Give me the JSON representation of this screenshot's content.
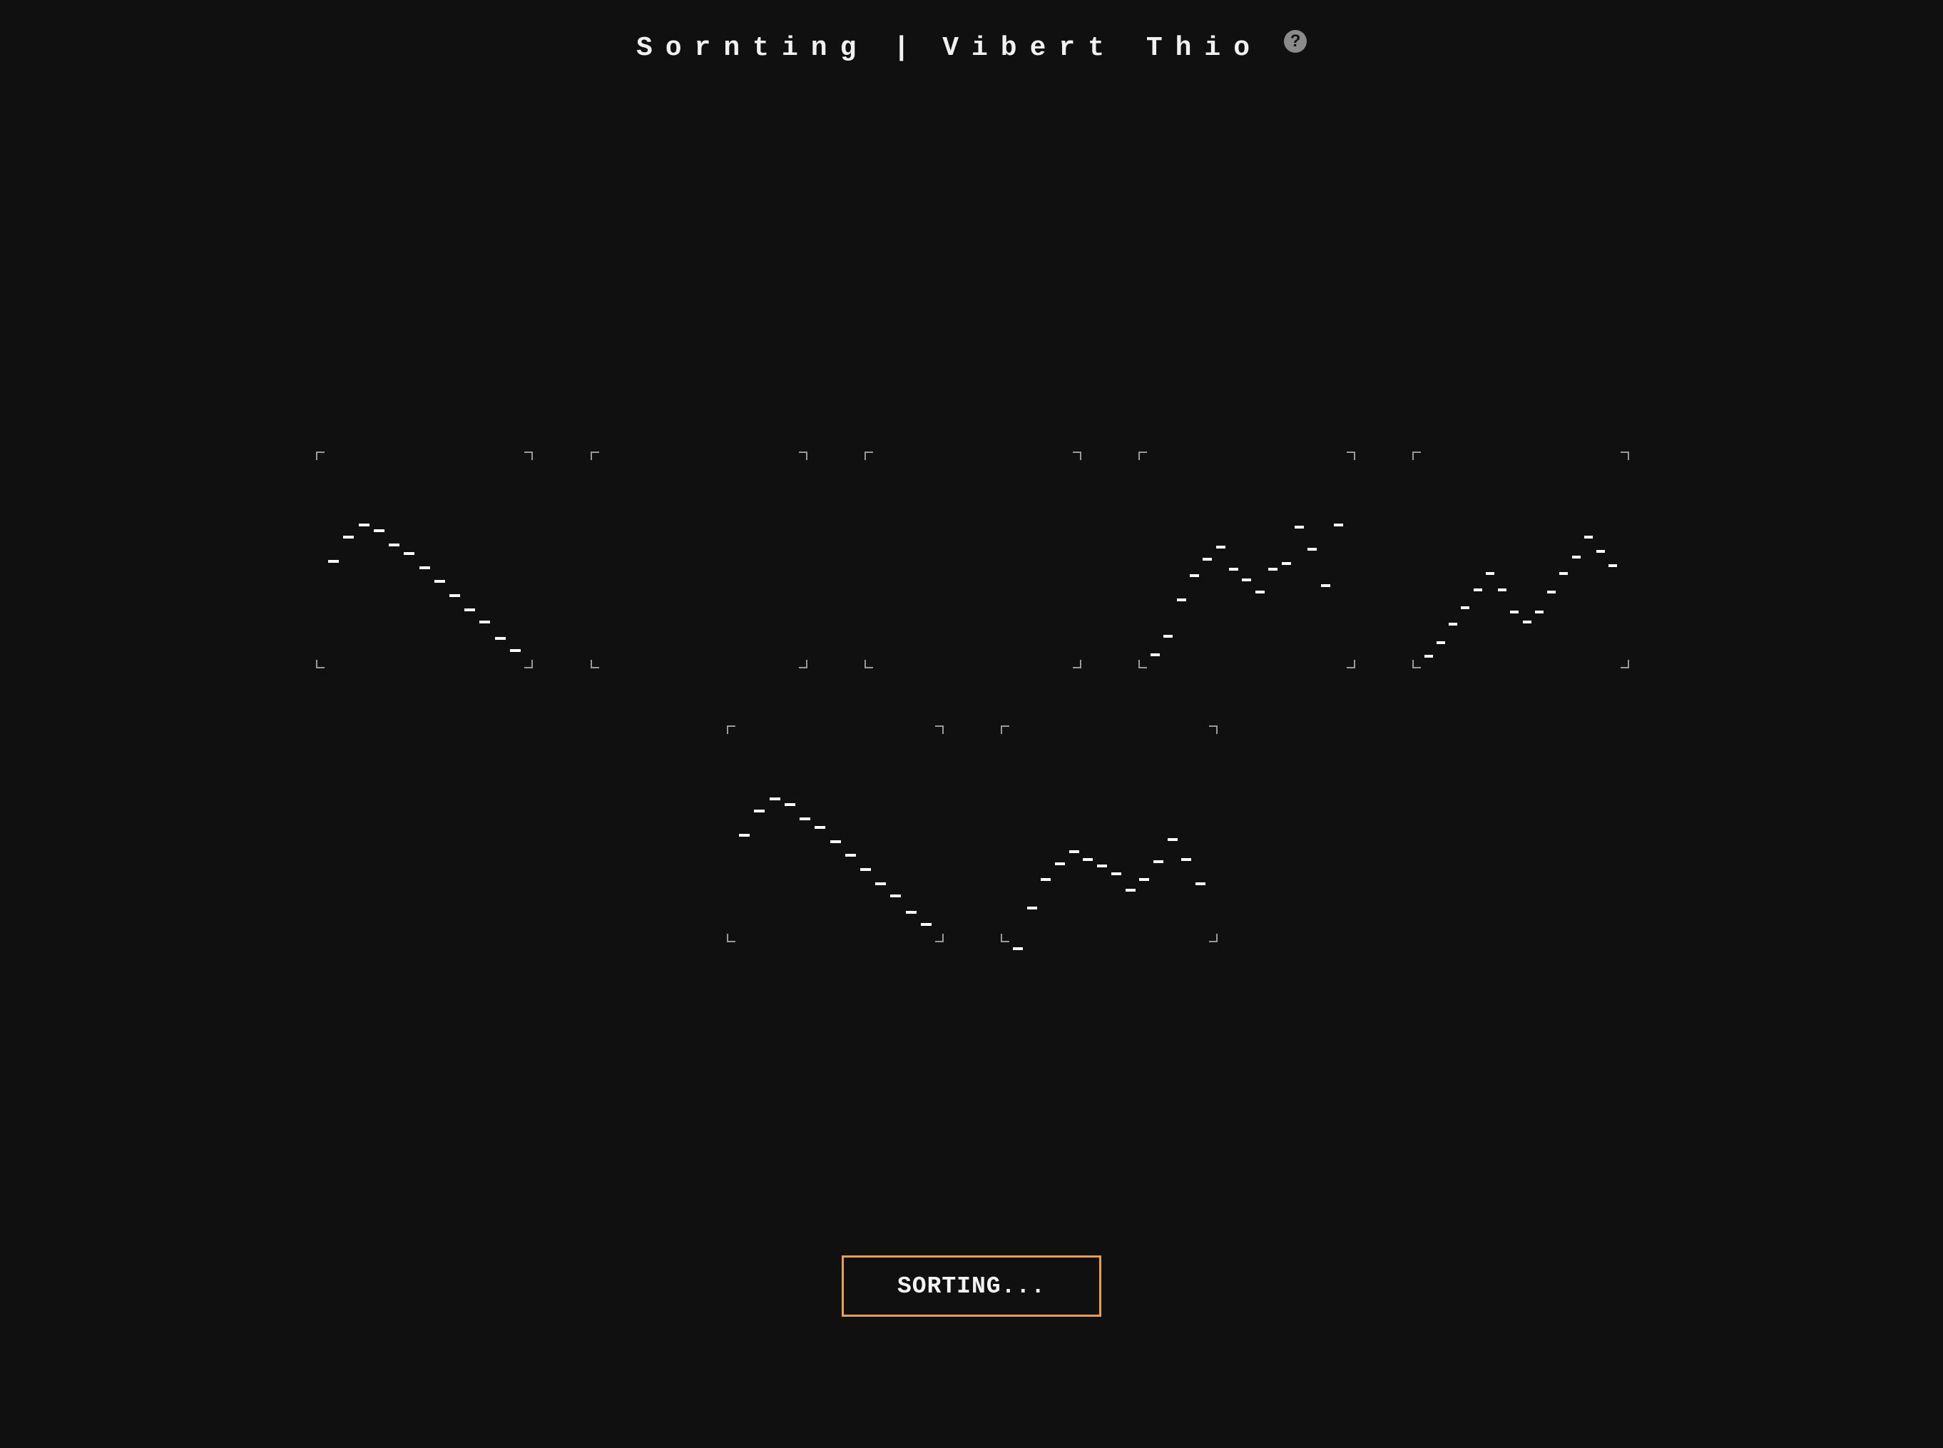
{
  "header": {
    "title": "Sornting",
    "separator": "|",
    "author": "Vibert Thio",
    "help_icon": "question-mark-icon",
    "help_glyph": "?"
  },
  "visualizers": [
    {
      "id": "top-1",
      "values": [
        0.5,
        0.62,
        0.68,
        0.65,
        0.58,
        0.54,
        0.47,
        0.4,
        0.33,
        0.26,
        0.2,
        0.12,
        0.06
      ]
    },
    {
      "id": "top-2",
      "values": []
    },
    {
      "id": "top-3",
      "values": []
    },
    {
      "id": "top-4",
      "values": [
        0.04,
        0.13,
        0.31,
        0.43,
        0.51,
        0.57,
        0.46,
        0.41,
        0.35,
        0.46,
        0.49,
        0.67,
        0.56,
        0.38,
        0.68
      ]
    },
    {
      "id": "top-5",
      "values": [
        0.03,
        0.1,
        0.19,
        0.27,
        0.36,
        0.44,
        0.36,
        0.25,
        0.2,
        0.25,
        0.35,
        0.44,
        0.52,
        0.62,
        0.55,
        0.48
      ]
    },
    {
      "id": "bottom-1",
      "values": [
        0.5,
        0.62,
        0.68,
        0.65,
        0.58,
        0.54,
        0.47,
        0.4,
        0.33,
        0.26,
        0.2,
        0.12,
        0.06
      ]
    },
    {
      "id": "bottom-2",
      "values": [
        -0.06,
        0.14,
        0.28,
        0.36,
        0.42,
        0.38,
        0.35,
        0.31,
        0.23,
        0.28,
        0.37,
        0.48,
        0.38,
        0.26
      ]
    }
  ],
  "colors": {
    "background": "#101010",
    "accent": "#e8a04a",
    "mark": "#ffffff"
  },
  "button": {
    "label": "SORTING..."
  }
}
